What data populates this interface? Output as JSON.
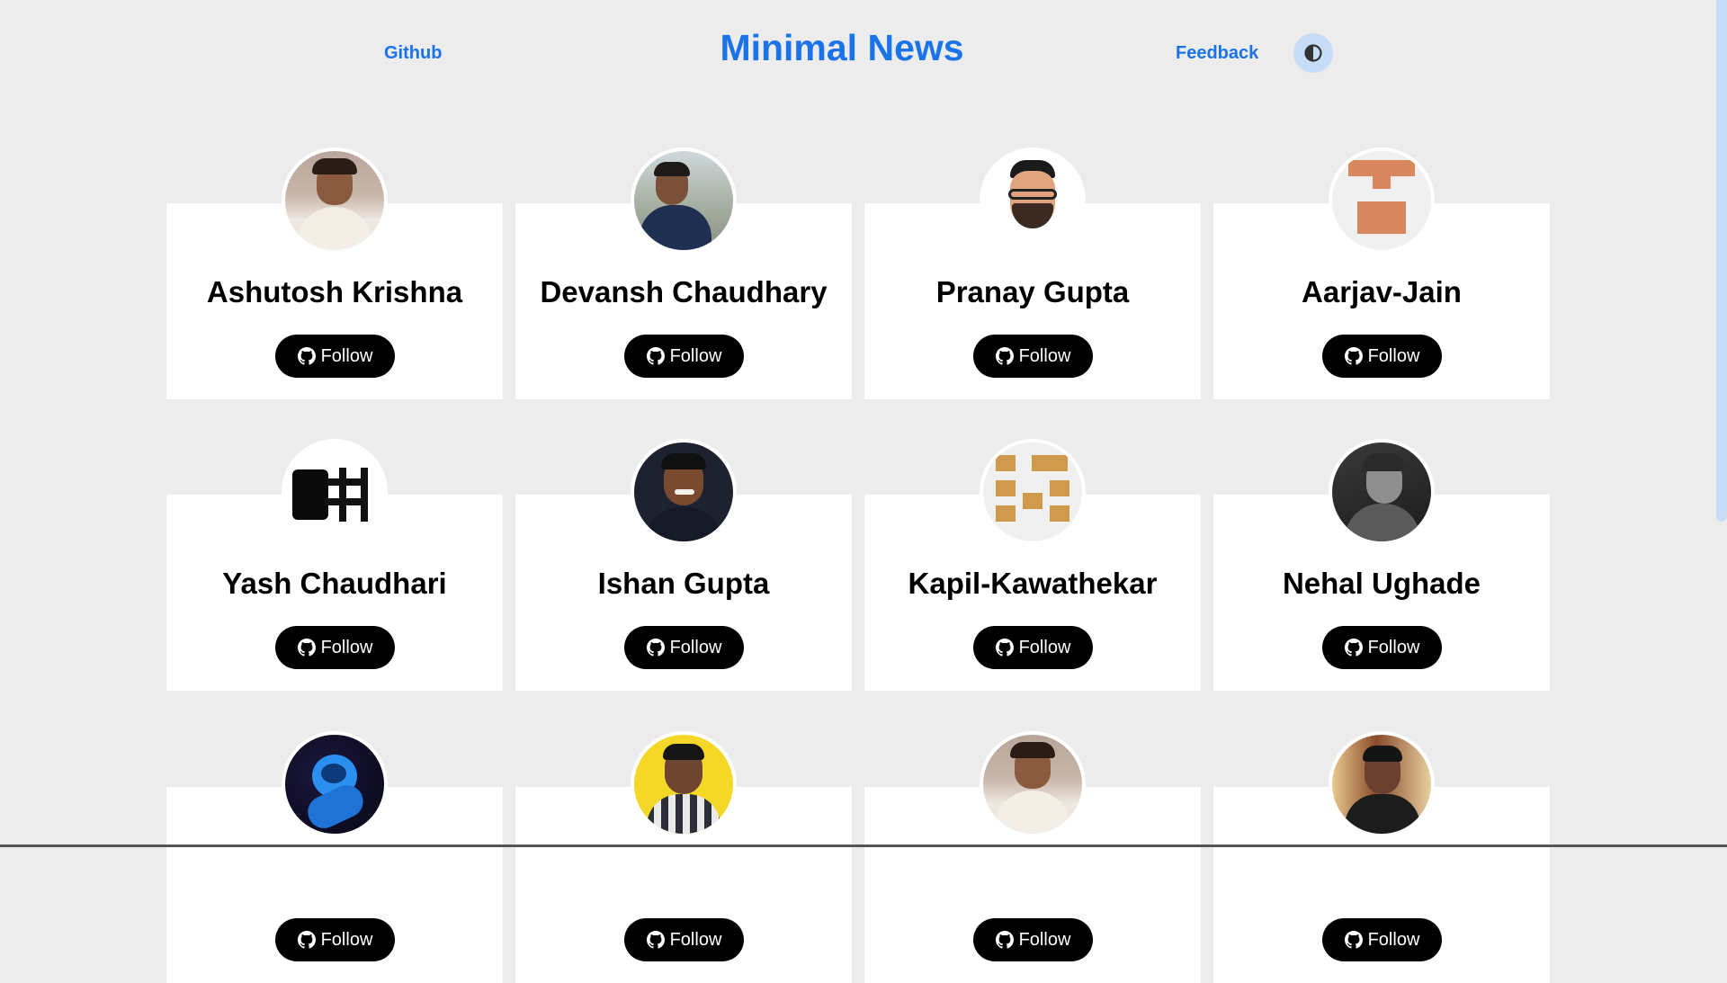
{
  "header": {
    "github_label": "Github",
    "title": "Minimal News",
    "feedback_label": "Feedback",
    "theme_icon": "contrast-icon",
    "accent": "#1a73e8"
  },
  "cards": [
    {
      "name": "Ashutosh Krishna",
      "follow_label": "Follow"
    },
    {
      "name": "Devansh Chaudhary",
      "follow_label": "Follow"
    },
    {
      "name": "Pranay Gupta",
      "follow_label": "Follow"
    },
    {
      "name": "Aarjav-Jain",
      "follow_label": "Follow"
    },
    {
      "name": "Yash Chaudhari",
      "follow_label": "Follow"
    },
    {
      "name": "Ishan Gupta",
      "follow_label": "Follow"
    },
    {
      "name": "Kapil-Kawathekar",
      "follow_label": "Follow"
    },
    {
      "name": "Nehal Ughade",
      "follow_label": "Follow"
    },
    {
      "name": "",
      "follow_label": "Follow"
    },
    {
      "name": "",
      "follow_label": "Follow"
    },
    {
      "name": "",
      "follow_label": "Follow"
    },
    {
      "name": "",
      "follow_label": "Follow"
    }
  ]
}
